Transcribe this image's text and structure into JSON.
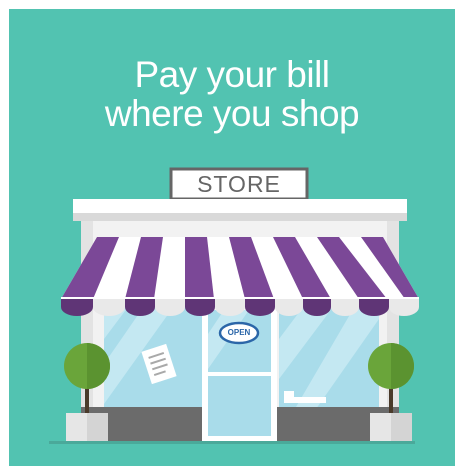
{
  "headline": {
    "line1": "Pay your bill",
    "line2": "where you shop"
  },
  "store": {
    "sign_label": "STORE",
    "door_sign_label": "OPEN"
  },
  "colors": {
    "background": "#52c3b1",
    "awning_stripe": "#7b4897",
    "awning_stripe_dark": "#5f3576",
    "awning_white": "#ffffff",
    "glass": "#a9dcea",
    "planter": "#e6e6e6",
    "tree": "#6aa53a"
  }
}
